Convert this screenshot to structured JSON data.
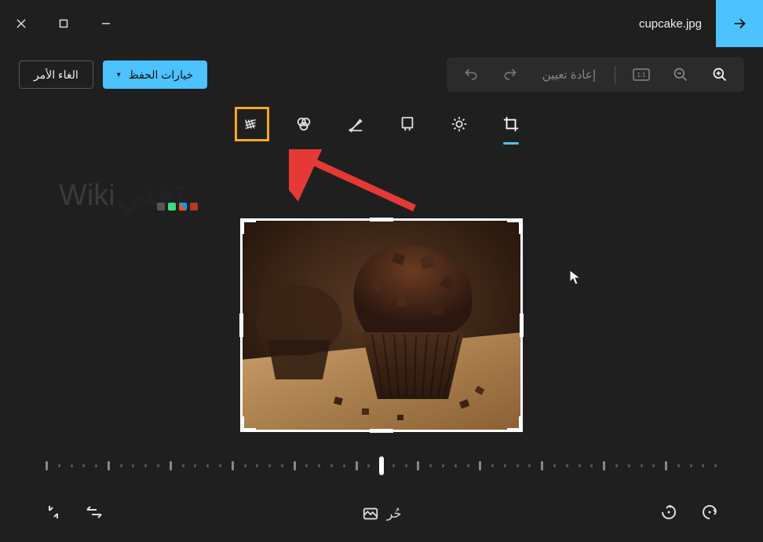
{
  "titlebar": {
    "filename": "cupcake.jpg"
  },
  "actions": {
    "save_options_label": "خيارات الحفظ",
    "cancel_label": "الغاء الأمر",
    "reset_label": "إعادة تعيين"
  },
  "tabs": {
    "crop_name": "crop",
    "adjust_name": "adjust",
    "filter_name": "filter",
    "markup_name": "markup",
    "retouch_name": "retouch",
    "ai_name": "background"
  },
  "bottom": {
    "free_label": "حُر"
  },
  "watermark": {
    "en": "Wiki",
    "ar": "تقني"
  }
}
